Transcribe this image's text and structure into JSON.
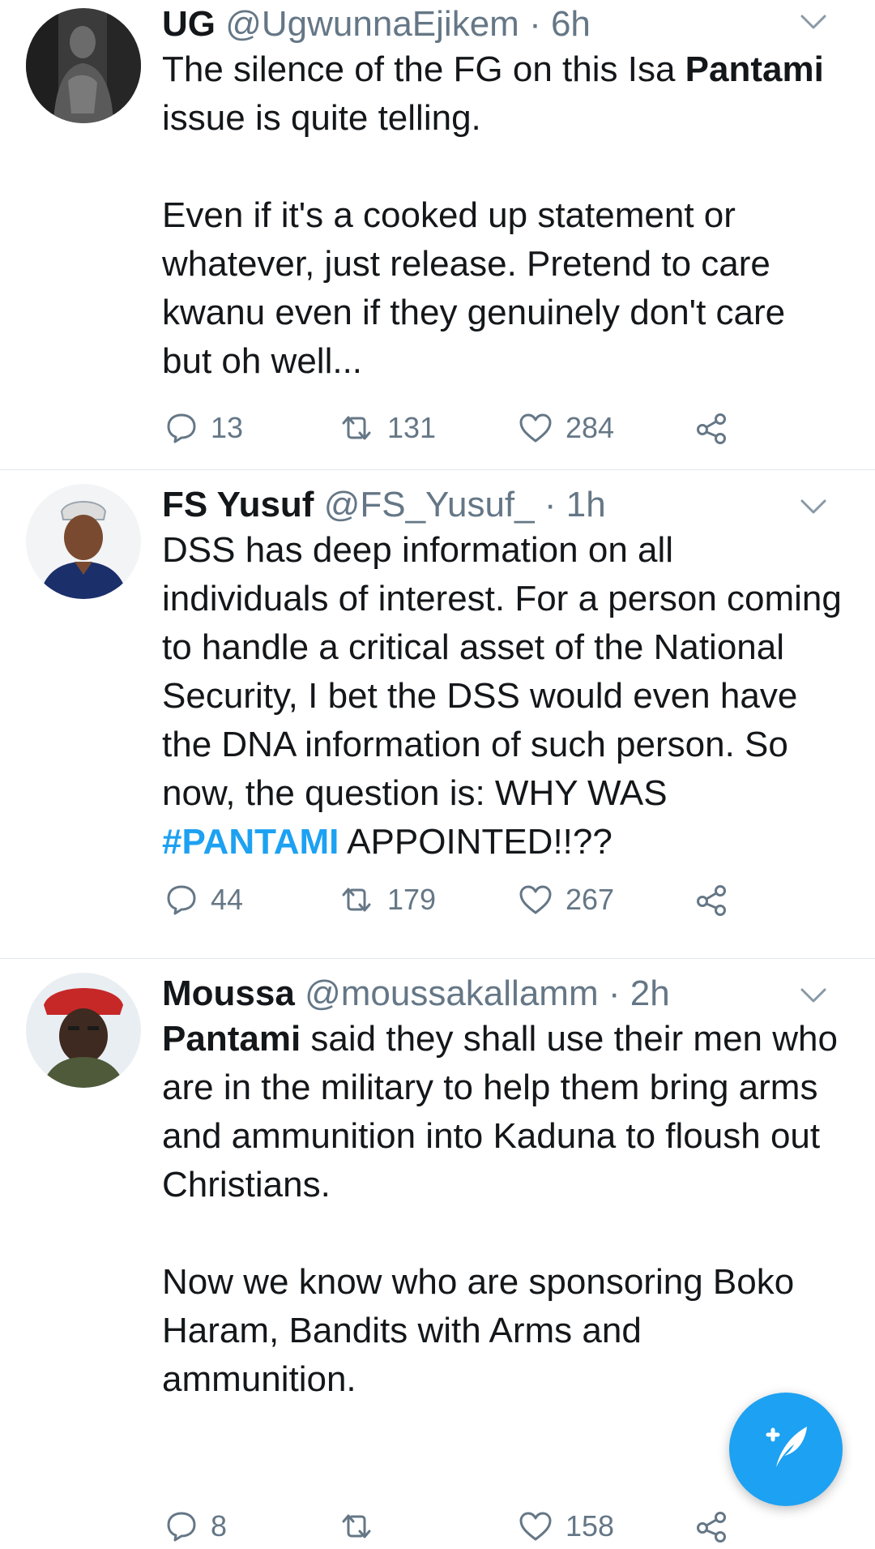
{
  "tweets": [
    {
      "name": "UG",
      "handle": "@UgwunnaEjikem",
      "dot": "·",
      "time": "6h",
      "text_p1_a": "The silence of the FG on this Isa ",
      "text_p1_b": "Pantami",
      "text_p1_c": " issue is quite telling.",
      "text_p2": "Even if it's a cooked up statement or whatever, just release. Pretend to care kwanu even if they genuinely don't care but oh well...",
      "replies": "13",
      "retweets": "131",
      "likes": "284"
    },
    {
      "name": "FS Yusuf",
      "handle": "@FS_Yusuf_",
      "dot": "·",
      "time": "1h",
      "text_a": "DSS has deep information on all individuals of interest. For a person coming to handle a critical asset of the National Security, I bet the DSS would even have the DNA information of such person. So now, the question is: WHY WAS ",
      "hashtag": "#PANTAMI",
      "text_b": " APPOINTED!!??",
      "replies": "44",
      "retweets": "179",
      "likes": "267"
    },
    {
      "name": "Moussa",
      "handle": "@moussakallamm",
      "dot": "·",
      "time": "2h",
      "text_p1_a": "Pantami",
      "text_p1_b": " said they shall use their men who are in the military to help them bring arms and ammunition into Kaduna to floush out Christians.",
      "text_p2": "Now we know who are sponsoring Boko Haram, Bandits with Arms and ammunition.",
      "replies": "8",
      "retweets": "",
      "likes": "158"
    }
  ],
  "icons": {
    "more": "chevron-down-icon",
    "reply": "reply-bubble-icon",
    "retweet": "retweet-icon",
    "like": "heart-icon",
    "share": "share-icon",
    "compose": "compose-tweet-icon"
  },
  "colors": {
    "accent": "#1da1f2",
    "secondary_text": "#657786",
    "primary_text": "#14171a",
    "divider": "#e1e8ed"
  }
}
